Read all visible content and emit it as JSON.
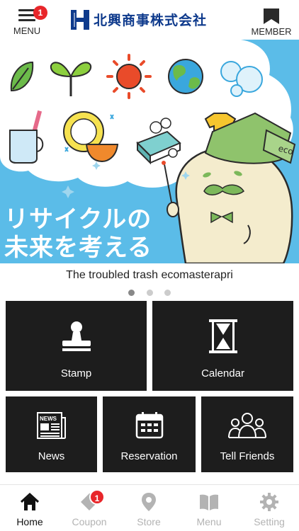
{
  "header": {
    "menu_label": "MENU",
    "menu_badge": "1",
    "logo_text": "北興商事株式会社",
    "member_label": "MEMBER"
  },
  "banner": {
    "line1": "リサイクルの",
    "line2": "未来を考える",
    "sign_text": "eco"
  },
  "carousel": {
    "caption": "The troubled trash ecomasterapri",
    "page_count": 3,
    "active_index": 0
  },
  "tiles": [
    {
      "label": "Stamp",
      "icon": "stamp-icon"
    },
    {
      "label": "Calendar",
      "icon": "hourglass-icon"
    },
    {
      "label": "News",
      "icon": "newspaper-icon",
      "icon_text": "NEWS"
    },
    {
      "label": "Reservation",
      "icon": "calendar-grid-icon"
    },
    {
      "label": "Tell Friends",
      "icon": "people-icon"
    }
  ],
  "tabbar": {
    "items": [
      {
        "label": "Home",
        "icon": "home-icon",
        "active": true
      },
      {
        "label": "Coupon",
        "icon": "tag-icon",
        "badge": "1"
      },
      {
        "label": "Store",
        "icon": "map-pin-icon"
      },
      {
        "label": "Menu",
        "icon": "book-icon"
      },
      {
        "label": "Setting",
        "icon": "gear-icon"
      }
    ]
  },
  "colors": {
    "header_text": "#2a2a2a",
    "logo_blue": "#0e3a8c",
    "badge_red": "#e8262a",
    "banner_blue": "#5bbce8",
    "tile_bg": "#1d1d1d",
    "tab_active": "#111111",
    "tab_inactive": "#b3b3b3"
  }
}
